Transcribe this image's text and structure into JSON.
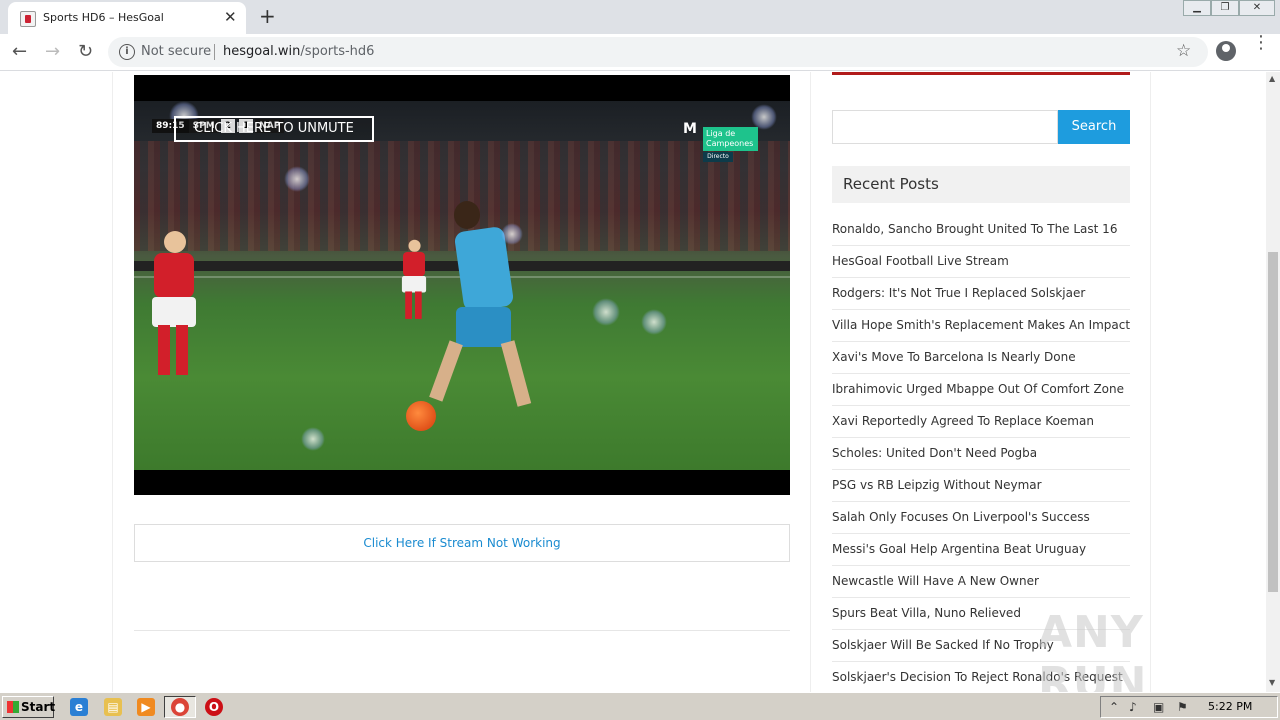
{
  "browser": {
    "tab_title": "Sports HD6 – HesGoal",
    "security_label": "Not secure",
    "url_domain": "hesgoal.win",
    "url_path": "/sports-hd6"
  },
  "player": {
    "unmute_label": "CLICK HERE TO UNMUTE",
    "scorebug": {
      "time": "89:15",
      "home": "SPM",
      "home_score": "2",
      "away_score": "1",
      "away": "NAP"
    },
    "broadcaster": "M",
    "league_badge": "Liga de Campeones",
    "live_badge": "Directo"
  },
  "stream_link": "Click Here If Stream Not Working",
  "sidebar": {
    "search_button": "Search",
    "search_placeholder": "",
    "recent_heading": "Recent Posts",
    "posts": [
      "Ronaldo, Sancho Brought United To The Last 16",
      "HesGoal Football Live Stream",
      "Rodgers: It's Not True I Replaced Solskjaer",
      "Villa Hope Smith's Replacement Makes An Impact",
      "Xavi's Move To Barcelona Is Nearly Done",
      "Ibrahimovic Urged Mbappe Out Of Comfort Zone",
      "Xavi Reportedly Agreed To Replace Koeman",
      "Scholes: United Don't Need Pogba",
      "PSG vs RB Leipzig Without Neymar",
      "Salah Only Focuses On Liverpool's Success",
      "Messi's Goal Help Argentina Beat Uruguay",
      "Newcastle Will Have A New Owner",
      "Spurs Beat Villa, Nuno Relieved",
      "Solskjaer Will Be Sacked If No Trophy",
      "Solskjaer's Decision To Reject Ronaldo's Request"
    ]
  },
  "watermark": "ANY RUN",
  "taskbar": {
    "start_label": "Start",
    "clock": "5:22 PM"
  },
  "colors": {
    "accent": "#1e9cde",
    "link": "#1a8bd0",
    "brand_red": "#b11b1b"
  }
}
